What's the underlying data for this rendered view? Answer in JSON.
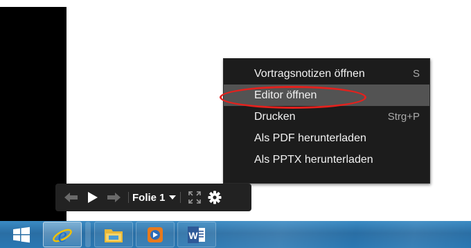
{
  "menu": {
    "items": [
      {
        "label": "Vortragsnotizen öffnen",
        "shortcut": "S"
      },
      {
        "label": "Editor öffnen",
        "shortcut": ""
      },
      {
        "label": "Drucken",
        "shortcut": "Strg+P"
      },
      {
        "label": "Als PDF herunterladen",
        "shortcut": ""
      },
      {
        "label": "Als PPTX herunterladen",
        "shortcut": ""
      }
    ],
    "highlighted_index": 1,
    "annotation_color": "#e3211d"
  },
  "toolbar": {
    "slide_label": "Folie 1",
    "icons": [
      "prev-arrow-icon",
      "play-icon",
      "next-arrow-icon",
      "chevron-down-icon",
      "fullscreen-icon",
      "gear-icon"
    ]
  },
  "taskbar": {
    "apps": [
      "windows-start-icon",
      "internet-explorer-icon",
      "file-explorer-icon",
      "media-player-icon",
      "word-icon"
    ],
    "accent": "#2a6ea4"
  }
}
